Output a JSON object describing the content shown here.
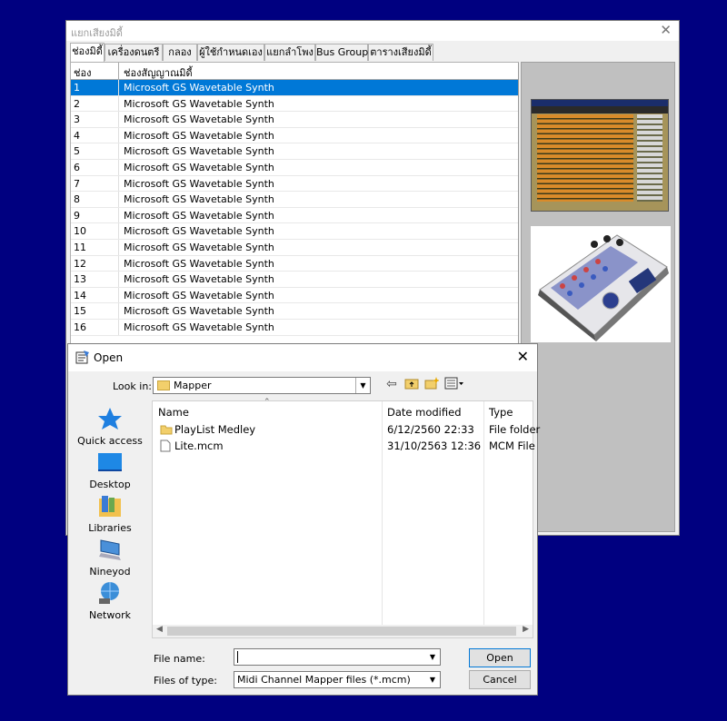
{
  "main_window": {
    "title": "แยกเสียงมิดี้",
    "tabs": [
      "ช่องมิดี้",
      "เครื่องดนตรี",
      "กลอง",
      "ผู้ใช้กำหนดเอง",
      "แยกลำโพง",
      "Bus Group",
      "ตารางเสียงมิดี้"
    ],
    "active_tab": "ช่องมิดี้",
    "grid": {
      "headers": [
        "ช่อง",
        "ช่องสัญญาณมิดี้"
      ],
      "rows": [
        {
          "ch": "1",
          "device": "Microsoft GS Wavetable Synth"
        },
        {
          "ch": "2",
          "device": "Microsoft GS Wavetable Synth"
        },
        {
          "ch": "3",
          "device": "Microsoft GS Wavetable Synth"
        },
        {
          "ch": "4",
          "device": "Microsoft GS Wavetable Synth"
        },
        {
          "ch": "5",
          "device": "Microsoft GS Wavetable Synth"
        },
        {
          "ch": "6",
          "device": "Microsoft GS Wavetable Synth"
        },
        {
          "ch": "7",
          "device": "Microsoft GS Wavetable Synth"
        },
        {
          "ch": "8",
          "device": "Microsoft GS Wavetable Synth"
        },
        {
          "ch": "9",
          "device": "Microsoft GS Wavetable Synth"
        },
        {
          "ch": "10",
          "device": "Microsoft GS Wavetable Synth"
        },
        {
          "ch": "11",
          "device": "Microsoft GS Wavetable Synth"
        },
        {
          "ch": "12",
          "device": "Microsoft GS Wavetable Synth"
        },
        {
          "ch": "13",
          "device": "Microsoft GS Wavetable Synth"
        },
        {
          "ch": "14",
          "device": "Microsoft GS Wavetable Synth"
        },
        {
          "ch": "15",
          "device": "Microsoft GS Wavetable Synth"
        },
        {
          "ch": "16",
          "device": "Microsoft GS Wavetable Synth"
        }
      ],
      "selected_row": "1"
    }
  },
  "dialog": {
    "title": "Open",
    "look_in_label": "Look in:",
    "look_in_value": "Mapper",
    "places": [
      "Quick access",
      "Desktop",
      "Libraries",
      "Nineyod",
      "Network"
    ],
    "columns": [
      "Name",
      "Date modified",
      "Type"
    ],
    "files": [
      {
        "name": "PlayList Medley",
        "date": "6/12/2560 22:33",
        "type": "File folder",
        "icon": "folder-icon"
      },
      {
        "name": "Lite.mcm",
        "date": "31/10/2563 12:36",
        "type": "MCM File",
        "icon": "file-icon"
      }
    ],
    "file_name_label": "File name:",
    "file_name_value": "",
    "files_of_type_label": "Files of type:",
    "files_of_type_value": "Midi Channel Mapper files (*.mcm)",
    "open_button": "Open",
    "cancel_button": "Cancel"
  },
  "colors": {
    "desktop": "#000080",
    "selection": "#0078d7"
  }
}
